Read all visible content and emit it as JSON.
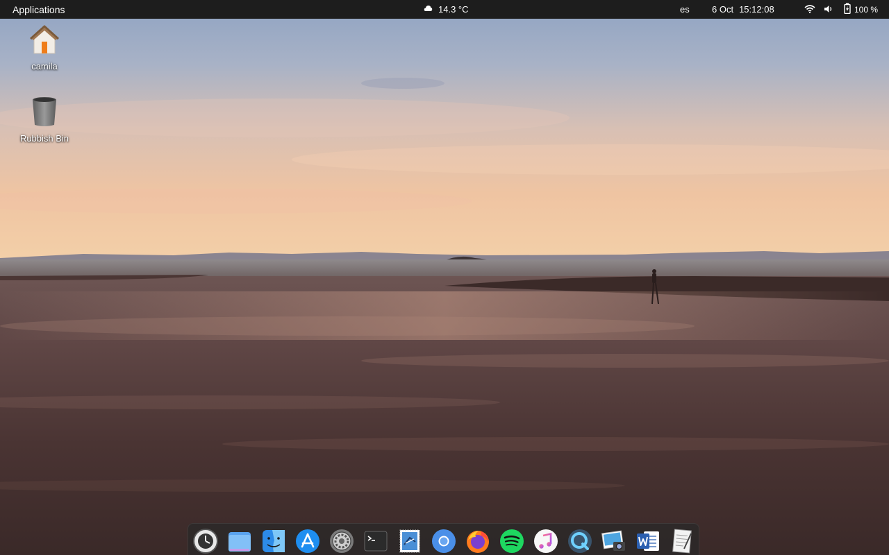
{
  "topbar": {
    "applications_label": "Applications",
    "weather": {
      "icon": "cloud-icon",
      "text": "14.3 °C"
    },
    "language": "es",
    "date": "6 Oct",
    "time": "15:12:08",
    "wifi_icon": "wifi-icon",
    "volume_icon": "volume-icon",
    "battery": {
      "icon": "battery-charging-icon",
      "percent": "100 %"
    },
    "background_color": "#1d1d1d"
  },
  "desktop": {
    "icons": [
      {
        "label": "camila",
        "icon": "home-folder-icon"
      },
      {
        "label": "Rubbish Bin",
        "icon": "trash-icon"
      }
    ]
  },
  "dock": {
    "apps": [
      {
        "name": "timeshift",
        "icon": "backup-clock-icon"
      },
      {
        "name": "files",
        "icon": "folder-icon"
      },
      {
        "name": "finder",
        "icon": "finder-face-icon"
      },
      {
        "name": "app-store",
        "icon": "app-store-icon"
      },
      {
        "name": "system-settings",
        "icon": "gear-icon"
      },
      {
        "name": "terminal",
        "icon": "terminal-icon"
      },
      {
        "name": "mail",
        "icon": "mail-stamp-icon"
      },
      {
        "name": "chromium",
        "icon": "chromium-icon"
      },
      {
        "name": "firefox",
        "icon": "firefox-icon"
      },
      {
        "name": "spotify",
        "icon": "spotify-icon"
      },
      {
        "name": "music",
        "icon": "music-note-icon"
      },
      {
        "name": "browser",
        "icon": "browser-q-icon"
      },
      {
        "name": "screenshot",
        "icon": "camera-photo-icon"
      },
      {
        "name": "word",
        "icon": "word-icon"
      },
      {
        "name": "text-editor",
        "icon": "text-editor-icon"
      }
    ]
  }
}
